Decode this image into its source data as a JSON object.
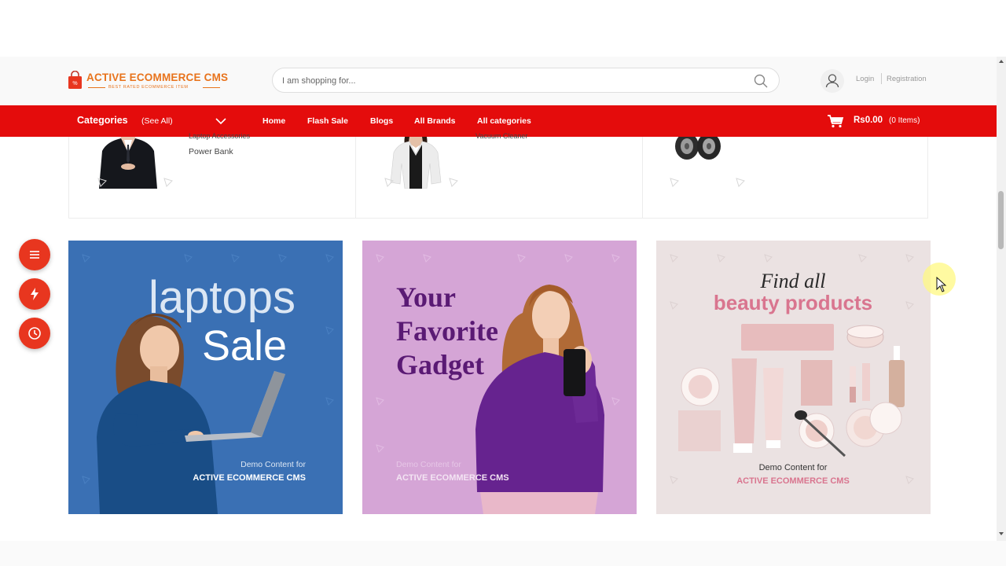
{
  "brand": {
    "name": "ACTIVE ECOMMERCE CMS",
    "tagline": "BEST RATED ECOMMERCE ITEM",
    "primary_color": "#e40c0c",
    "logo_color": "#e8731c"
  },
  "search": {
    "placeholder": "I am shopping for...",
    "icon": "search-icon"
  },
  "account": {
    "login": "Login",
    "registration": "Registration"
  },
  "nav": {
    "categories_label": "Categories",
    "see_all": "(See All)",
    "links": [
      "Home",
      "Flash Sale",
      "Blogs",
      "All Brands",
      "All categories"
    ],
    "cart_amount": "Rs0.00",
    "cart_items": "(0 Items)"
  },
  "category_strip": [
    {
      "cutoff_text": "Laptop Accessories",
      "text": "Power Bank"
    },
    {
      "cutoff_text": "Vacuum Cleaner",
      "text": ""
    },
    {
      "cutoff_text": "",
      "text": ""
    }
  ],
  "banners": [
    {
      "headline_1": "laptops",
      "headline_2": "Sale",
      "demo_label": "Demo Content for",
      "demo_brand": "ACTIVE ECOMMERCE CMS",
      "background": "#3a70b4"
    },
    {
      "headline_1": "Your",
      "headline_2": "Favorite",
      "headline_3": "Gadget",
      "demo_label": "Demo Content for",
      "demo_brand": "ACTIVE ECOMMERCE CMS",
      "background": "#d5a5d6"
    },
    {
      "headline_1": "Find all",
      "headline_2": "beauty products",
      "demo_label": "Demo Content for",
      "demo_brand": "ACTIVE ECOMMERCE CMS",
      "background": "#ebe2e2"
    }
  ],
  "floating_buttons": [
    "menu-icon",
    "flash-icon",
    "clock-icon"
  ]
}
